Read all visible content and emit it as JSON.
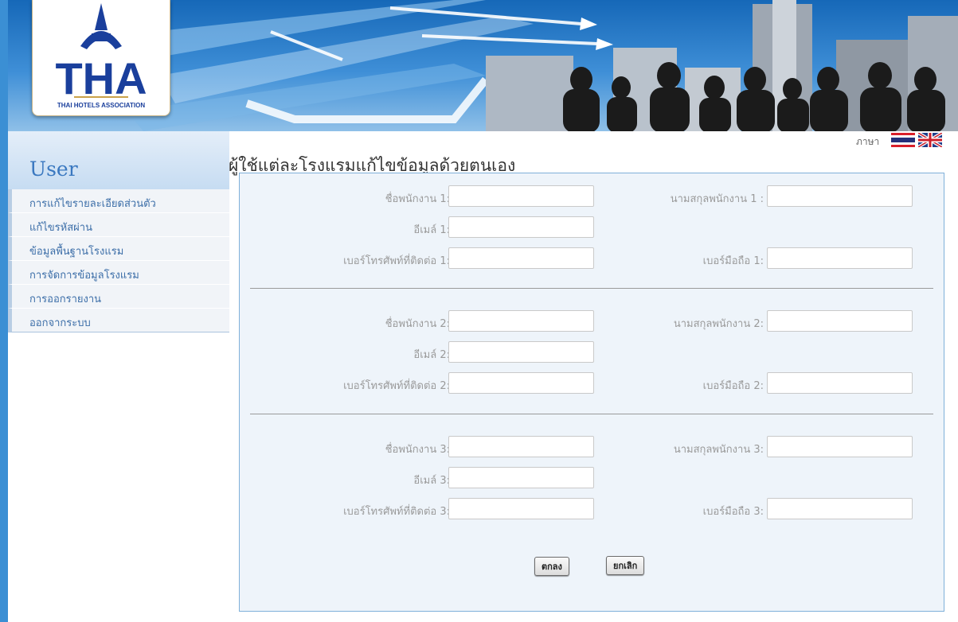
{
  "header": {
    "logo_text": "THA",
    "logo_subtitle": "THAI HOTELS ASSOCIATION"
  },
  "sidebar": {
    "title": "User",
    "items": [
      {
        "label": "การแก้ไขรายละเอียดส่วนตัว"
      },
      {
        "label": "แก้ไขรหัสผ่าน"
      },
      {
        "label": "ข้อมูลพื้นฐานโรงแรม"
      },
      {
        "label": "การจัดการข้อมูลโรงแรม"
      },
      {
        "label": "การออกรายงาน"
      },
      {
        "label": "ออกจากระบบ"
      }
    ]
  },
  "language": {
    "label": "ภาษา",
    "flags": [
      "thai-flag-icon",
      "uk-flag-icon"
    ]
  },
  "page": {
    "title": "ผู้ใช้แต่ละโรงแรมแก้ไขข้อมูลด้วยตนเอง"
  },
  "form": {
    "groups": [
      {
        "first_name_label": "ชื่อพนักงาน 1:",
        "last_name_label": "นามสกุลพนักงาน 1 :",
        "email_label": "อีเมล์ 1:",
        "phone_label": "เบอร์โทรศัพท์ที่ติดต่อ 1:",
        "mobile_label": "เบอร์มือถือ 1:",
        "first_name_value": "",
        "last_name_value": "",
        "email_value": "",
        "phone_value": "",
        "mobile_value": ""
      },
      {
        "first_name_label": "ชื่อพนักงาน 2:",
        "last_name_label": "นามสกุลพนักงาน 2:",
        "email_label": "อีเมล์ 2:",
        "phone_label": "เบอร์โทรศัพท์ที่ติดต่อ 2:",
        "mobile_label": "เบอร์มือถือ 2:",
        "first_name_value": "",
        "last_name_value": "",
        "email_value": "",
        "phone_value": "",
        "mobile_value": ""
      },
      {
        "first_name_label": "ชื่อพนักงาน 3:",
        "last_name_label": "นามสกุลพนักงาน 3:",
        "email_label": "อีเมล์ 3:",
        "phone_label": "เบอร์โทรศัพท์ที่ติดต่อ 3:",
        "mobile_label": "เบอร์มือถือ 3:",
        "first_name_value": "",
        "last_name_value": "",
        "email_value": "",
        "phone_value": "",
        "mobile_value": ""
      }
    ],
    "ok_label": "ตกลง",
    "cancel_label": "ยกเลิก"
  },
  "colors": {
    "accent": "#3b8fd4",
    "sidebar_link": "#3c6ea8",
    "panel_bg": "#eef4fa",
    "panel_border": "#7fb0d9"
  }
}
